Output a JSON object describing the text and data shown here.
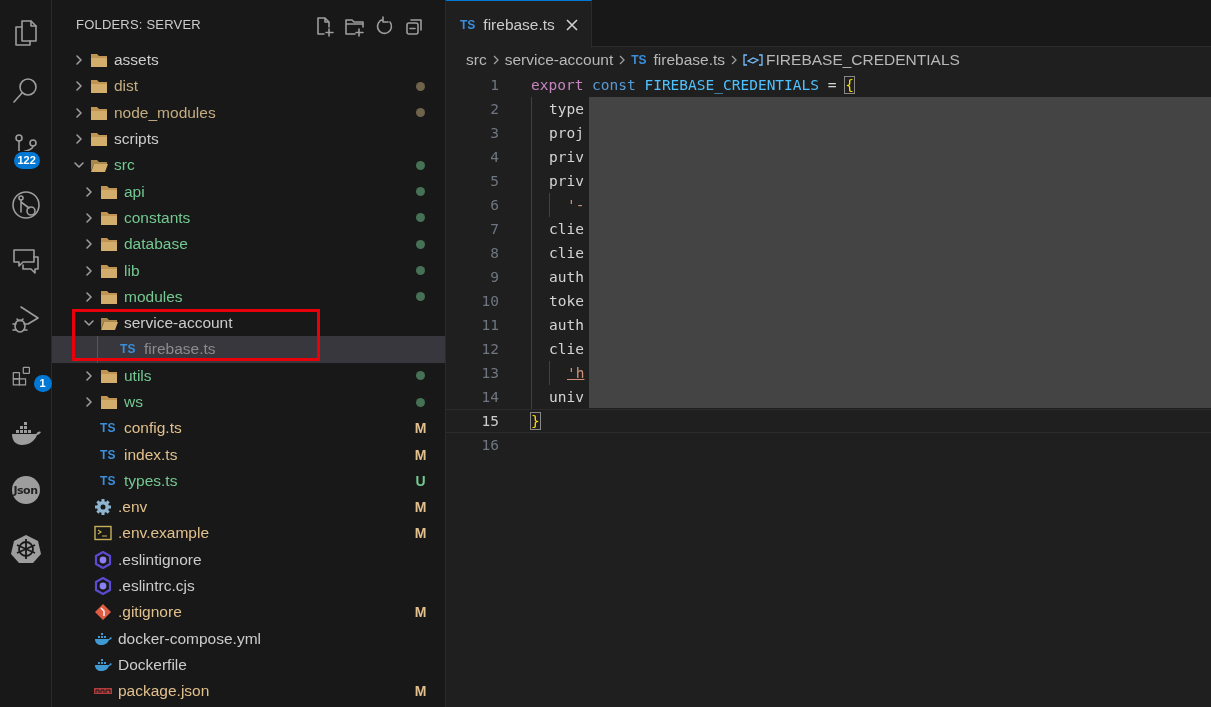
{
  "activity_bar": [
    {
      "kind": "explorer"
    },
    {
      "kind": "search"
    },
    {
      "kind": "source-control",
      "badge": "122"
    },
    {
      "kind": "remote-explorer"
    },
    {
      "kind": "chat"
    },
    {
      "kind": "run-debug"
    },
    {
      "kind": "extensions",
      "badge": "1"
    },
    {
      "kind": "docker"
    },
    {
      "kind": "json",
      "label": "Json"
    },
    {
      "kind": "kubernetes"
    }
  ],
  "explorer": {
    "title": "FOLDERS: SERVER",
    "tree": [
      {
        "name": "assets",
        "kind": "folder",
        "expanded": false,
        "selected": false,
        "color": "#cccccc",
        "dot": false
      },
      {
        "name": "dist",
        "kind": "folder",
        "expanded": false,
        "selected": false,
        "color": "#c5ad80",
        "dot": true
      },
      {
        "name": "node_modules",
        "kind": "folder",
        "expanded": false,
        "selected": false,
        "color": "#c5ad80",
        "dot": true
      },
      {
        "name": "scripts",
        "kind": "folder",
        "expanded": false,
        "selected": false,
        "color": "#cccccc",
        "dot": false
      },
      {
        "name": "src",
        "kind": "folder",
        "expanded": true,
        "selected": false,
        "color": "#73c991",
        "dot": true,
        "children": [
          {
            "name": "api",
            "kind": "folder",
            "expanded": false,
            "selected": false,
            "color": "#73c991",
            "dot": true
          },
          {
            "name": "constants",
            "kind": "folder",
            "expanded": false,
            "selected": false,
            "color": "#73c991",
            "dot": true
          },
          {
            "name": "database",
            "kind": "folder",
            "expanded": false,
            "selected": false,
            "color": "#73c991",
            "dot": true
          },
          {
            "name": "lib",
            "kind": "folder",
            "expanded": false,
            "selected": false,
            "color": "#73c991",
            "dot": true
          },
          {
            "name": "modules",
            "kind": "folder",
            "expanded": false,
            "selected": false,
            "color": "#73c991",
            "dot": true
          },
          {
            "name": "service-account",
            "kind": "folder",
            "expanded": true,
            "selected": false,
            "color": "#cccccc",
            "dot": false,
            "children": [
              {
                "name": "firebase.ts",
                "kind": "ts",
                "icon": "TS",
                "selected": true,
                "color": "#8c8c8c",
                "dot": false
              }
            ]
          },
          {
            "name": "utils",
            "kind": "folder",
            "expanded": false,
            "selected": false,
            "color": "#73c991",
            "dot": true
          },
          {
            "name": "ws",
            "kind": "folder",
            "expanded": false,
            "selected": false,
            "color": "#73c991",
            "dot": true
          },
          {
            "name": "config.ts",
            "kind": "ts",
            "icon": "TS",
            "selected": false,
            "color": "#e2c08d",
            "dot": false,
            "badge": "M"
          },
          {
            "name": "index.ts",
            "kind": "ts",
            "icon": "TS",
            "selected": false,
            "color": "#e2c08d",
            "dot": false,
            "badge": "M"
          },
          {
            "name": "types.ts",
            "kind": "ts",
            "icon": "TS",
            "selected": false,
            "color": "#73c991",
            "dot": false,
            "badge": "U"
          }
        ]
      },
      {
        "name": ".env",
        "kind": "gear",
        "selected": false,
        "color": "#e2c08d",
        "dot": false,
        "badge": "M"
      },
      {
        "name": ".env.example",
        "kind": "terminal",
        "selected": false,
        "color": "#e2c08d",
        "dot": false,
        "badge": "M"
      },
      {
        "name": ".eslintignore",
        "kind": "eslint",
        "selected": false,
        "color": "#cccccc",
        "dot": false
      },
      {
        "name": ".eslintrc.cjs",
        "kind": "eslint",
        "selected": false,
        "color": "#cccccc",
        "dot": false
      },
      {
        "name": ".gitignore",
        "kind": "git",
        "selected": false,
        "color": "#e2c08d",
        "dot": false,
        "badge": "M"
      },
      {
        "name": "docker-compose.yml",
        "kind": "docker",
        "selected": false,
        "color": "#cccccc",
        "dot": false
      },
      {
        "name": "Dockerfile",
        "kind": "docker",
        "selected": false,
        "color": "#cccccc",
        "dot": false
      },
      {
        "name": "package.json",
        "kind": "npm",
        "selected": false,
        "color": "#e2c08d",
        "dot": false,
        "badge": "M"
      }
    ]
  },
  "editor": {
    "tabs": [
      {
        "label": "firebase.ts",
        "icon": "TS",
        "selected": true
      }
    ],
    "breadcrumb": [
      {
        "kind": "folder",
        "label": "src"
      },
      {
        "kind": "folder",
        "label": "service-account"
      },
      {
        "kind": "file",
        "icon": "TS",
        "label": "firebase.ts"
      },
      {
        "kind": "symbol",
        "label": "FIREBASE_CREDENTIALS"
      }
    ],
    "lines": [
      {
        "number": "1",
        "kind": "top",
        "tokens": [
          {
            "kind": "keyword",
            "text": "export"
          },
          {
            "kind": "storage",
            "text": "const"
          },
          {
            "kind": "constant",
            "text": "FIREBASE_CREDENTIALS"
          },
          {
            "kind": "plain",
            "text": "="
          },
          {
            "kind": "bracket",
            "text": "{"
          }
        ]
      },
      {
        "number": "2",
        "kind": "property",
        "tokens": [
          {
            "kind": "plain",
            "text": "type"
          }
        ]
      },
      {
        "number": "3",
        "kind": "property",
        "tokens": [
          {
            "kind": "plain",
            "text": "proj"
          }
        ]
      },
      {
        "number": "4",
        "kind": "property",
        "tokens": [
          {
            "kind": "plain",
            "text": "priv"
          }
        ]
      },
      {
        "number": "5",
        "kind": "property",
        "tokens": [
          {
            "kind": "plain",
            "text": "priv"
          }
        ]
      },
      {
        "number": "6",
        "kind": "continuation",
        "tokens": [
          {
            "kind": "string",
            "text": "'-"
          }
        ]
      },
      {
        "number": "7",
        "kind": "property",
        "tokens": [
          {
            "kind": "plain",
            "text": "clie"
          }
        ]
      },
      {
        "number": "8",
        "kind": "property",
        "tokens": [
          {
            "kind": "plain",
            "text": "clie"
          }
        ]
      },
      {
        "number": "9",
        "kind": "property",
        "tokens": [
          {
            "kind": "plain",
            "text": "auth"
          }
        ]
      },
      {
        "number": "10",
        "kind": "property",
        "tokens": [
          {
            "kind": "plain",
            "text": "toke"
          }
        ]
      },
      {
        "number": "11",
        "kind": "property",
        "tokens": [
          {
            "kind": "plain",
            "text": "auth"
          }
        ]
      },
      {
        "number": "12",
        "kind": "property",
        "tokens": [
          {
            "kind": "plain",
            "text": "clie"
          }
        ]
      },
      {
        "number": "13",
        "kind": "continuation",
        "tokens": [
          {
            "kind": "link",
            "text": "'h"
          }
        ]
      },
      {
        "number": "14",
        "kind": "property",
        "tokens": [
          {
            "kind": "plain",
            "text": "univ"
          }
        ]
      },
      {
        "number": "15",
        "kind": "top",
        "current": true,
        "tokens": [
          {
            "kind": "bracket",
            "text": "}"
          }
        ]
      },
      {
        "number": "16",
        "kind": "top"
      }
    ]
  }
}
